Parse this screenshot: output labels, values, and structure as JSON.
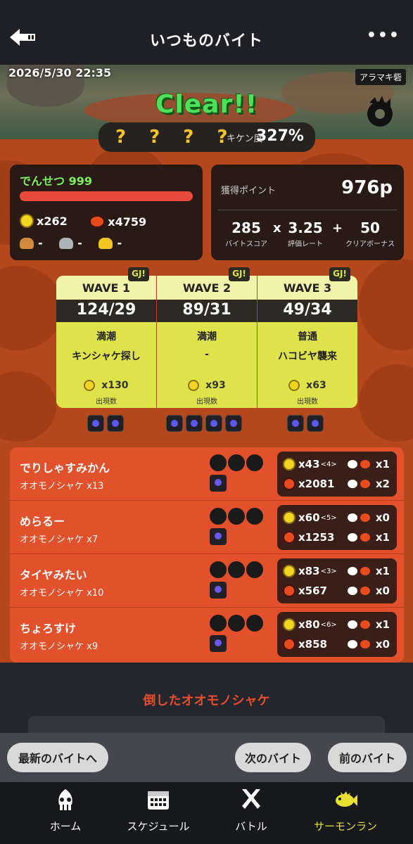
{
  "header": {
    "title": "いつものバイト",
    "more": "•••"
  },
  "banner": {
    "datetime": "2026/5/30 22:35",
    "stage": "アラマキ砦",
    "result": "Clear!!",
    "king_marks": "? ? ? ?",
    "hazard_label": "キケン度",
    "hazard_value": "327%"
  },
  "player_card": {
    "rank": "でんせつ 999",
    "golden_eggs": "x262",
    "power_eggs": "x4759",
    "scales": {
      "bronze": "-",
      "silver": "-",
      "gold": "-"
    }
  },
  "points": {
    "label": "獲得ポイント",
    "total": "976p",
    "base": "285",
    "base_label": "バイトスコア",
    "op1": "x",
    "rate": "3.25",
    "rate_label": "評価レート",
    "op2": "+",
    "bonus": "50",
    "bonus_label": "クリアボーナス"
  },
  "waves": [
    {
      "name": "WAVE 1",
      "score": "124/29",
      "tide": "満潮",
      "event": "キンシャケ探し",
      "appear": "x130",
      "appear_label": "出現数",
      "gj": "GJ!"
    },
    {
      "name": "WAVE 2",
      "score": "89/31",
      "tide": "満潮",
      "event": "-",
      "appear": "x93",
      "appear_label": "出現数",
      "gj": "GJ!"
    },
    {
      "name": "WAVE 3",
      "score": "49/34",
      "tide": "普通",
      "event": "ハコビヤ襲来",
      "appear": "x63",
      "appear_label": "出現数",
      "gj": "GJ!"
    }
  ],
  "players": [
    {
      "name": "でりしゃすみかん",
      "kills": "オオモノシャケ x13",
      "golden": "x43",
      "assist": "<4>",
      "power": "x2081",
      "rescue": "x1",
      "rescued": "x2"
    },
    {
      "name": "めらるー",
      "kills": "オオモノシャケ x7",
      "golden": "x60",
      "assist": "<5>",
      "power": "x1253",
      "rescue": "x0",
      "rescued": "x1"
    },
    {
      "name": "タイヤみたい",
      "kills": "オオモノシャケ x10",
      "golden": "x83",
      "assist": "<3>",
      "power": "x567",
      "rescue": "x1",
      "rescued": "x0"
    },
    {
      "name": "ちょろすけ",
      "kills": "オオモノシャケ x9",
      "golden": "x80",
      "assist": "<6>",
      "power": "x858",
      "rescue": "x1",
      "rescued": "x0"
    }
  ],
  "defeated_title": "倒したオオモノシャケ",
  "nav": {
    "latest": "最新のバイトへ",
    "next": "次のバイト",
    "prev": "前のバイト"
  },
  "tabs": [
    {
      "label": "ホーム",
      "icon": "squid-icon"
    },
    {
      "label": "スケジュール",
      "icon": "calendar-icon"
    },
    {
      "label": "バトル",
      "icon": "battle-icon"
    },
    {
      "label": "サーモンラン",
      "icon": "salmon-icon",
      "active": true
    }
  ],
  "colors": {
    "accent": "#e8e030",
    "salmon": "#e3512c",
    "wave": "#dfe34a",
    "rank": "#7cf05a"
  }
}
